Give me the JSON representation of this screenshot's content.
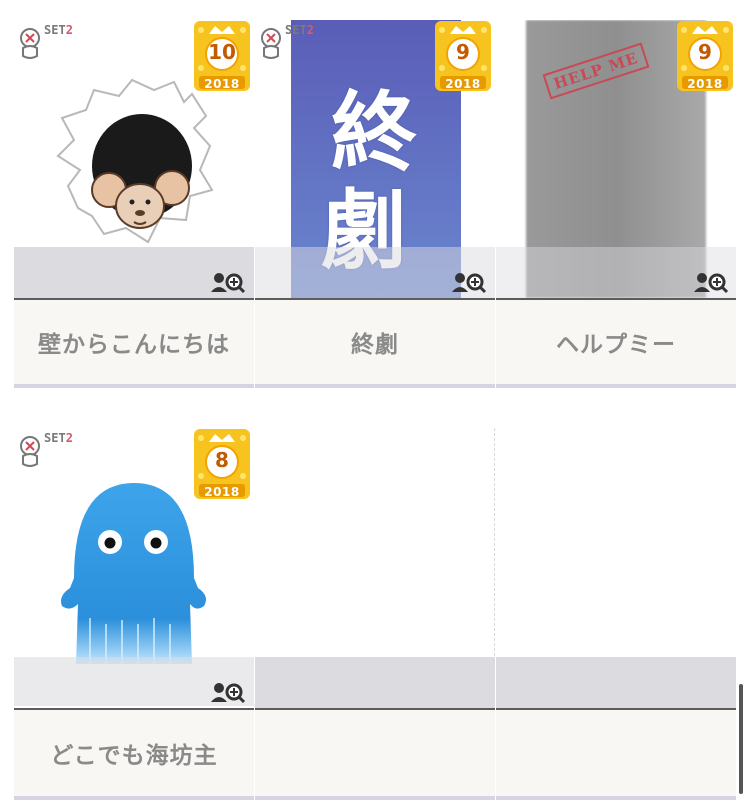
{
  "cards": [
    {
      "title": "壁からこんにちは",
      "rank": "10",
      "year": "2018",
      "set_label": "SET",
      "set_num": "2"
    },
    {
      "title": "終劇",
      "rank": "9",
      "year": "2018",
      "set_label": "SET",
      "set_num": "2",
      "art_text_1": "終",
      "art_text_2": "劇"
    },
    {
      "title": "ヘルプミー",
      "rank": "9",
      "year": "2018",
      "stamp": "HELP ME"
    },
    {
      "title": "どこでも海坊主",
      "rank": "8",
      "year": "2018",
      "set_label": "SET",
      "set_num": "2"
    }
  ],
  "colors": {
    "badge_gold": "#f7c41f",
    "shade": "#dcdbe0",
    "caption_bg": "#f8f7f3"
  },
  "icons": [
    "mark-x-icon",
    "rank-crown-badge",
    "zoom-icon"
  ]
}
